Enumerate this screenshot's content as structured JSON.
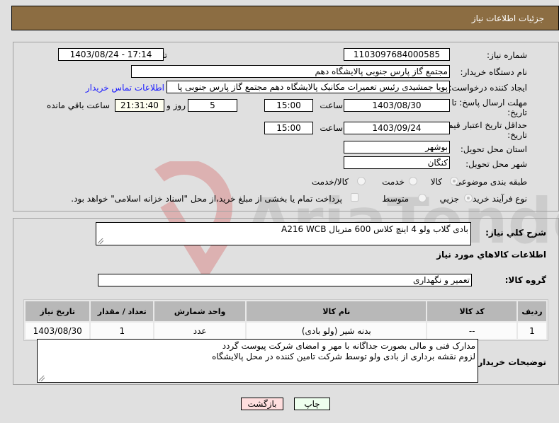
{
  "header": {
    "title": "جزئیات اطلاعات نیاز"
  },
  "form": {
    "need_number": {
      "label": "شماره نیاز:",
      "value": "1103097684000585"
    },
    "announce_datetime": {
      "label": "تاریخ و ساعت اعلان عمومی:",
      "value": "1403/08/24 - 17:14"
    },
    "buyer_org": {
      "label": "نام دستگاه خریدار:",
      "value": "مجتمع گاز پارس جنوبی  پالایشگاه دهم"
    },
    "requester": {
      "label": "ایجاد کننده درخواست:",
      "value": "پویا جمشیدی رئیس تعمیرات مکانیک پالایشگاه دهم  مجتمع گاز پارس جنوبی  پا",
      "contact_link": "اطلاعات تماس خریدار"
    },
    "reply_deadline": {
      "label": "مهلت ارسال پاسخ: تا تاریخ:",
      "date": "1403/08/30",
      "time_label": "ساعت",
      "time": "15:00",
      "days": "5",
      "days_label": "روز و",
      "remaining": "21:31:40",
      "remaining_label": "ساعت باقي مانده"
    },
    "price_validity": {
      "label": "حداقل تاریخ اعتبار قیمت: تا تاریخ:",
      "date": "1403/09/24",
      "time_label": "ساعت",
      "time": "15:00"
    },
    "province": {
      "label": "استان محل تحویل:",
      "value": "بوشهر"
    },
    "city": {
      "label": "شهر محل تحویل:",
      "value": "کنگان"
    },
    "category": {
      "label": "طبقه بندی موضوعی:",
      "options": [
        "کالا",
        "خدمت",
        "کالا/خدمت"
      ],
      "selected": "کالا"
    },
    "purchase_type": {
      "label": "نوع فرآیند خرید :",
      "options": [
        "جزیي",
        "متوسط"
      ],
      "selected": "جزیي",
      "checkbox_label": "پرداخت تمام یا بخشی از مبلغ خرید،از محل \"اسناد خزانه اسلامی\" خواهد بود.",
      "checkbox_checked": false
    }
  },
  "details": {
    "description": {
      "label": "شرح کلي نیاز:",
      "value": "بادی گلاب ولو 4 اینچ کلاس 600 متریال A216 WCB"
    },
    "goods_info_title": "اطلاعات کالاهاي مورد نیاز",
    "goods_group": {
      "label": "گروه کالا:",
      "value": "تعمیر و نگهداری"
    },
    "table": {
      "headers": [
        "ردیف",
        "کد کالا",
        "نام کالا",
        "واحد شمارش",
        "تعداد / مقدار",
        "تاریخ نیاز"
      ],
      "rows": [
        [
          "1",
          "--",
          "بدنه شیر (ولو بادی)",
          "عدد",
          "1",
          "1403/08/30"
        ]
      ]
    },
    "buyer_notes": {
      "label": "توضیحات خریدار:",
      "lines": [
        "مدارک فنی و مالی بصورت جداگانه با مهر و امضای شرکت پیوست گردد",
        "لزوم نقشه برداری از بادی ولو توسط شرکت تامین کننده در محل پالایشگاه"
      ]
    }
  },
  "buttons": {
    "print": "چاپ",
    "back": "بازگشت"
  },
  "watermark": {
    "text": "AriaTender.neT"
  },
  "colors": {
    "header_bg": "#8c6d42",
    "print_bg": "#eeffee",
    "back_bg": "#ffdede",
    "link": "#1a1aff"
  }
}
